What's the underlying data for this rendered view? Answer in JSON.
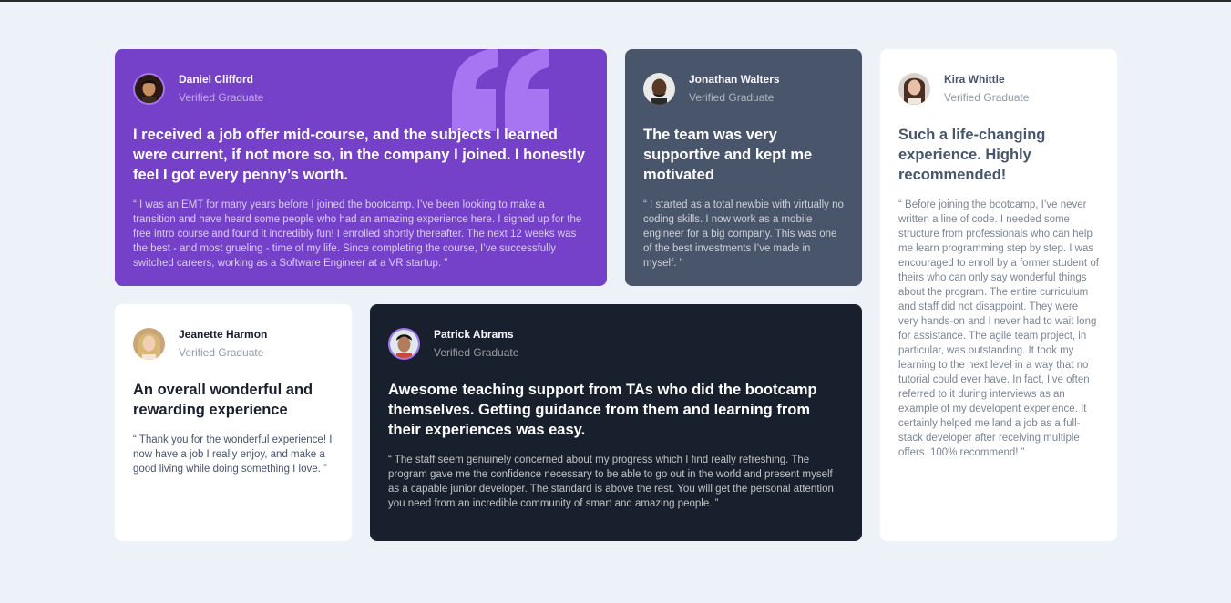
{
  "testimonials": [
    {
      "name": "Daniel Clifford",
      "role": "Verified Graduate",
      "headline": "I received a job offer mid-course, and the subjects I learned were current, if not more so, in the company I joined. I honestly feel I got every penny’s worth.",
      "body": "“ I was an EMT for many years before I joined the bootcamp. I’ve been looking to make a transition and have heard some people who had an amazing experience here. I signed up for the free intro course and found it incredibly fun! I enrolled shortly thereafter. The next 12 weeks was the best - and most grueling - time of my life. Since completing the course, I’ve successfully switched careers, working as a Software Engineer at a VR startup. ”"
    },
    {
      "name": "Jonathan Walters",
      "role": "Verified Graduate",
      "headline": "The team was very supportive and kept me motivated",
      "body": "“ I started as a total newbie with virtually no coding skills. I now work as a mobile engineer for a big company. This was one of the best investments I’ve made in myself. ”"
    },
    {
      "name": "Kira Whittle",
      "role": "Verified Graduate",
      "headline": "Such a life-changing experience. Highly recommended!",
      "body": "“ Before joining the bootcamp, I’ve never written a line of code. I needed some structure from professionals who can help me learn programming step by step. I was encouraged to enroll by a former student of theirs who can only say wonderful things about the program. The entire curriculum and staff did not disappoint. They were very hands-on and I never had to wait long for assistance. The agile team project, in particular, was outstanding. It took my learning to the next level in a way that no tutorial could ever have. In fact, I’ve often referred to it during interviews as an example of my developent experience. It certainly helped me land a job as a full-stack developer after receiving multiple offers. 100% recommend! ”"
    },
    {
      "name": "Jeanette Harmon",
      "role": "Verified Graduate",
      "headline": "An overall wonderful and rewarding experience",
      "body": "“ Thank you for the wonderful experience! I now have a job I really enjoy, and make a good living while doing something I love. ”"
    },
    {
      "name": "Patrick Abrams",
      "role": "Verified Graduate",
      "headline": "Awesome teaching support from TAs who did the bootcamp themselves. Getting guidance from them and learning from their experiences was easy.",
      "body": "“ The staff seem genuinely concerned about my progress which I find really refreshing. The program gave me the confidence necessary to be able to go out in the world and present myself as a capable junior developer. The standard is above the rest. You will get the personal attention you need from an incredible community of smart and amazing people. ”"
    }
  ],
  "colors": {
    "page_bg": "#edf1f8",
    "violet": "#7541c8",
    "grayish_blue": "#48556a",
    "blackish_blue": "#19202d",
    "white": "#ffffff",
    "quote_mark": "#a775f1"
  },
  "icons": [
    "quotation-mark-icon",
    "avatar-photo"
  ]
}
